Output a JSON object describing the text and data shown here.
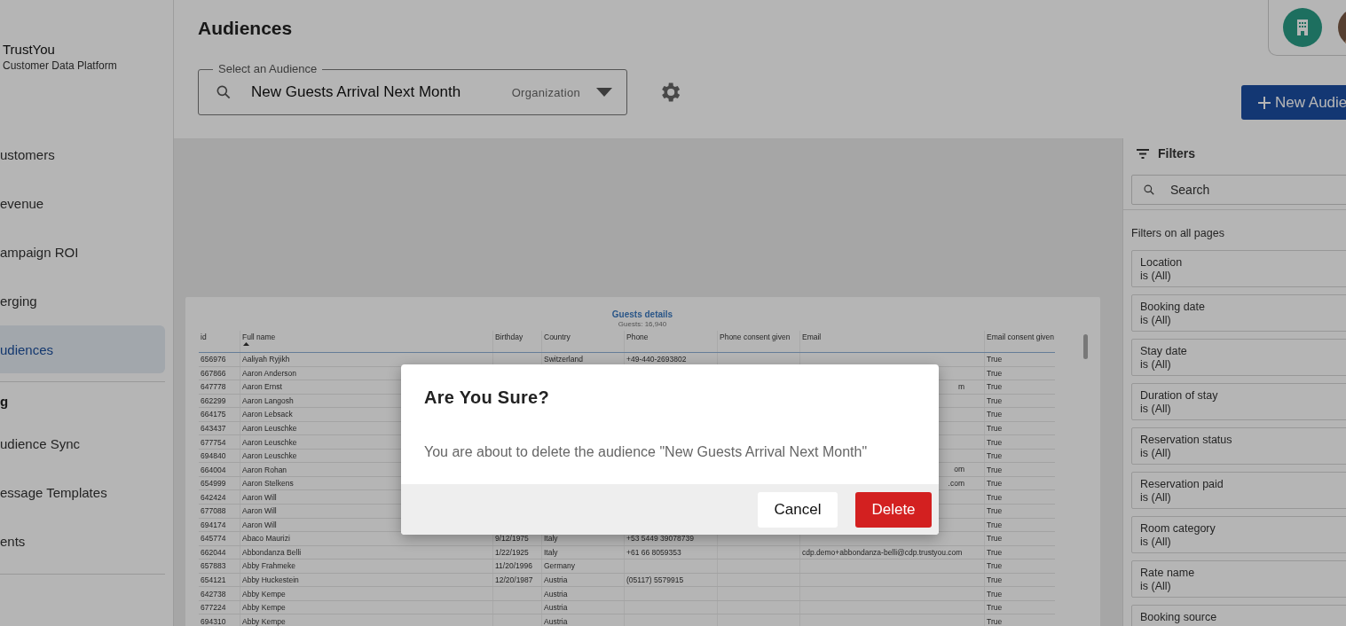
{
  "brand": {
    "name": "TrustYou",
    "subtitle": "Customer Data Platform"
  },
  "sidebar": {
    "items": [
      {
        "kind": "item",
        "label": "ustomers",
        "selected": false
      },
      {
        "kind": "item",
        "label": "evenue",
        "selected": false
      },
      {
        "kind": "item",
        "label": "ampaign ROI",
        "selected": false
      },
      {
        "kind": "item",
        "label": "erging",
        "selected": false
      },
      {
        "kind": "item",
        "label": "udiences",
        "selected": true
      },
      {
        "kind": "divider"
      },
      {
        "kind": "section",
        "label": "g"
      },
      {
        "kind": "item",
        "label": "udience Sync",
        "selected": false
      },
      {
        "kind": "item",
        "label": "essage Templates",
        "selected": false
      },
      {
        "kind": "item",
        "label": "ents",
        "selected": false
      },
      {
        "kind": "divider"
      }
    ]
  },
  "page_title": "Audiences",
  "audience_select": {
    "label": "Select an Audience",
    "value": "New Guests Arrival Next Month",
    "scope": "Organization"
  },
  "new_button": "New Audie",
  "table": {
    "title": "Guests details",
    "subtitle": "Guests: 16,940",
    "columns": [
      "id",
      "Full name",
      "Birthday",
      "Country",
      "Phone",
      "Phone consent given",
      "Email",
      "Email consent given"
    ],
    "rows": [
      {
        "id": "656976",
        "name": "Aaliyah Ryjikh",
        "country": "Switzerland",
        "phone": "+49-440-2693802",
        "email_consent": "True"
      },
      {
        "id": "667866",
        "name": "Aaron Anderson",
        "email_consent": "True"
      },
      {
        "id": "647778",
        "name": "Aaron Ernst",
        "email_tail": "m",
        "email_consent": "True"
      },
      {
        "id": "662299",
        "name": "Aaron Langosh",
        "email_consent": "True"
      },
      {
        "id": "664175",
        "name": "Aaron Lebsack",
        "email_consent": "True"
      },
      {
        "id": "643437",
        "name": "Aaron Leuschke",
        "email_consent": "True"
      },
      {
        "id": "677754",
        "name": "Aaron Leuschke",
        "email_consent": "True"
      },
      {
        "id": "694840",
        "name": "Aaron Leuschke",
        "email_consent": "True"
      },
      {
        "id": "664004",
        "name": "Aaron Rohan",
        "email_tail": "om",
        "email_consent": "True"
      },
      {
        "id": "654999",
        "name": "Aaron Stelkens",
        "email_tail": ".com",
        "email_consent": "True"
      },
      {
        "id": "642424",
        "name": "Aaron Will",
        "email_consent": "True"
      },
      {
        "id": "677088",
        "name": "Aaron Will",
        "email_consent": "True"
      },
      {
        "id": "694174",
        "name": "Aaron Will",
        "email_consent": "True"
      },
      {
        "id": "645774",
        "name": "Abaco Maurizi",
        "birthday": "9/12/1975",
        "country": "Italy",
        "phone": "+53 5449 39078739",
        "email_consent": "True"
      },
      {
        "id": "662044",
        "name": "Abbondanza Belli",
        "birthday": "1/22/1925",
        "country": "Italy",
        "phone": "+61 66 8059353",
        "email": "cdp.demo+abbondanza-belli@cdp.trustyou.com",
        "email_consent": "True"
      },
      {
        "id": "657883",
        "name": "Abby Frahmeke",
        "birthday": "11/20/1996",
        "country": "Germany",
        "email_consent": "True"
      },
      {
        "id": "654121",
        "name": "Abby Huckestein",
        "birthday": "12/20/1987",
        "country": "Austria",
        "phone": "(05117) 5579915",
        "email_consent": "True"
      },
      {
        "id": "642738",
        "name": "Abby Kempe",
        "country": "Austria",
        "email_consent": "True"
      },
      {
        "id": "677224",
        "name": "Abby Kempe",
        "country": "Austria",
        "email_consent": "True"
      },
      {
        "id": "694310",
        "name": "Abby Kempe",
        "country": "Austria",
        "email_consent": "True"
      }
    ]
  },
  "filters": {
    "title": "Filters",
    "search": {
      "placeholder": "Search"
    },
    "section": "Filters on all pages",
    "items": [
      {
        "name": "Location",
        "value": "is (All)"
      },
      {
        "name": "Booking date",
        "value": "is (All)"
      },
      {
        "name": "Stay date",
        "value": "is (All)"
      },
      {
        "name": "Duration of stay",
        "value": "is (All)"
      },
      {
        "name": "Reservation status",
        "value": "is (All)"
      },
      {
        "name": "Reservation paid",
        "value": "is (All)"
      },
      {
        "name": "Room category",
        "value": "is (All)"
      },
      {
        "name": "Rate name",
        "value": "is (All)"
      },
      {
        "name": "Booking source"
      }
    ]
  },
  "dialog": {
    "title": "Are You Sure?",
    "message": "You are about to delete the audience \"New Guests Arrival Next Month\"",
    "buttons": [
      {
        "label": "Cancel",
        "kind": "secondary"
      },
      {
        "label": "Delete",
        "kind": "danger"
      }
    ]
  }
}
